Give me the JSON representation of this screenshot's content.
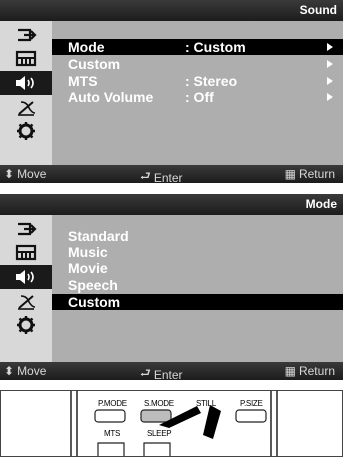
{
  "sound_menu": {
    "title": "Sound",
    "rows": [
      {
        "label": "Mode",
        "value": ": Custom"
      },
      {
        "label": "Custom",
        "value": ""
      },
      {
        "label": "MTS",
        "value": ": Stereo"
      },
      {
        "label": "Auto Volume",
        "value": ": Off"
      }
    ],
    "footer": {
      "move": "Move",
      "enter": "Enter",
      "return": "Return"
    }
  },
  "mode_menu": {
    "title": "Mode",
    "items": [
      "Standard",
      "Music",
      "Movie",
      "Speech",
      "Custom"
    ],
    "footer": {
      "move": "Move",
      "enter": "Enter",
      "return": "Return"
    }
  },
  "remote": {
    "buttons": [
      "P.MODE",
      "S.MODE",
      "STILL",
      "P.SIZE",
      "MTS",
      "SLEEP"
    ]
  }
}
